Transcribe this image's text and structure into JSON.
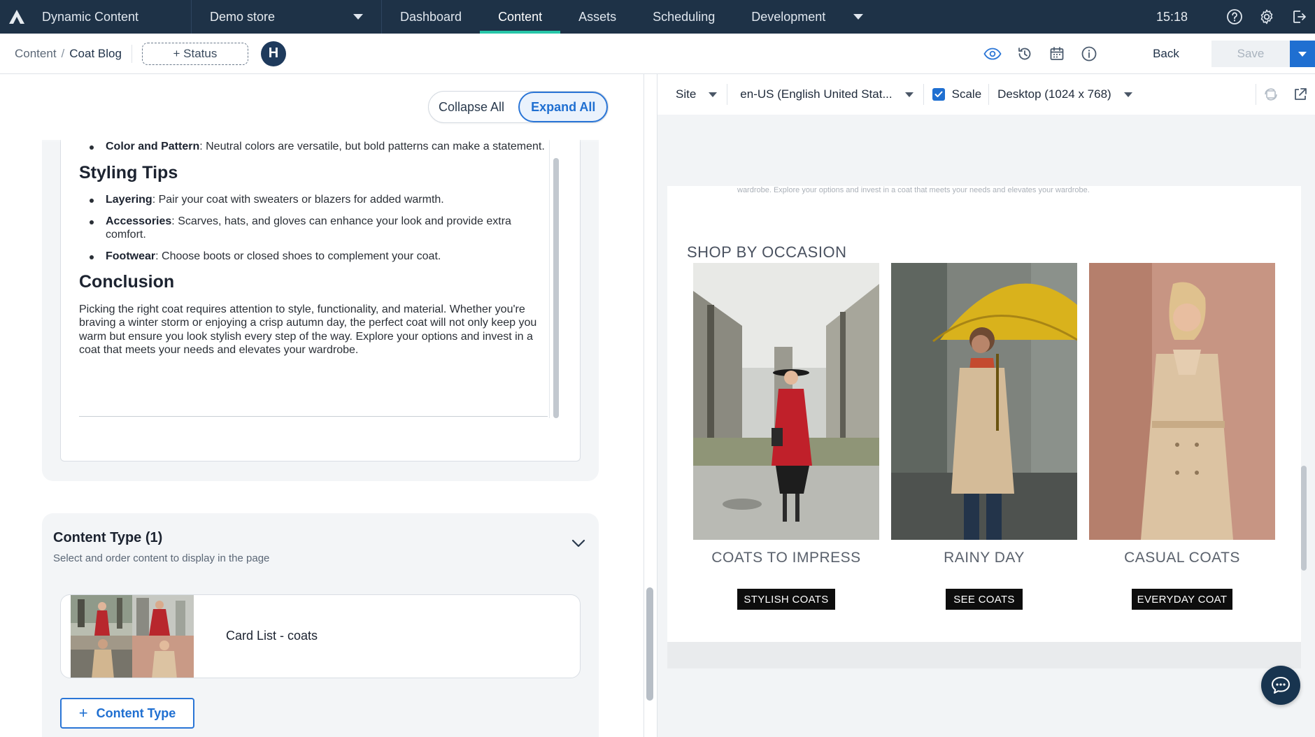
{
  "app": {
    "title": "Dynamic Content",
    "store": "Demo store",
    "time": "15:18"
  },
  "nav": {
    "tabs": [
      {
        "label": "Dashboard"
      },
      {
        "label": "Content"
      },
      {
        "label": "Assets"
      },
      {
        "label": "Scheduling"
      },
      {
        "label": "Development"
      }
    ],
    "active": "Content"
  },
  "subbar": {
    "breadcrumb_root": "Content",
    "breadcrumb_sep": "/",
    "breadcrumb_current": "Coat Blog",
    "status_label": "+ Status",
    "avatar_initial": "H",
    "back_label": "Back",
    "save_label": "Save"
  },
  "editor": {
    "collapse_all": "Collapse All",
    "expand_all": "Expand All",
    "cut_item_bold": "Color and Pattern",
    "cut_item_text": ": Neutral colors are versatile, but bold patterns can make a statement.",
    "styling_heading": "Styling Tips",
    "styling_items": [
      {
        "bold": "Layering",
        "text": ": Pair your coat with sweaters or blazers for added warmth."
      },
      {
        "bold": "Accessories",
        "text": ": Scarves, hats, and gloves can enhance your look and provide extra comfort."
      },
      {
        "bold": "Footwear",
        "text": ": Choose boots or closed shoes to complement your coat."
      }
    ],
    "conclusion_heading": "Conclusion",
    "conclusion_text": "Picking the right coat requires attention to style, functionality, and material. Whether you're braving a winter storm or enjoying a crisp autumn day, the perfect coat will not only keep you warm but ensure you look stylish every step of the way. Explore your options and invest in a coat that meets your needs and elevates your wardrobe."
  },
  "content_type": {
    "title": "Content Type (1)",
    "subtitle": "Select and order content to display in the page",
    "item_label": "Card List - coats",
    "add_label": "Content Type"
  },
  "preview": {
    "site_label": "Site",
    "locale_label": "en-US (English United Stat...",
    "scale_label": "Scale",
    "device_label": "Desktop (1024 x 768)",
    "faded_text": "wardrobe. Explore your options and invest in a coat that meets your needs and elevates your wardrobe.",
    "section_title": "SHOP BY OCCASION",
    "cards": [
      {
        "label": "COATS TO IMPRESS",
        "button": "STYLISH COATS"
      },
      {
        "label": "RAINY DAY",
        "button": "SEE COATS"
      },
      {
        "label": "CASUAL COATS",
        "button": "EVERYDAY COAT"
      }
    ]
  },
  "colors": {
    "nav_bg": "#1e3247",
    "accent_teal": "#27c6a8",
    "primary_blue": "#1f6fd1",
    "coat_red": "#c0202a",
    "umbrella_yellow": "#d9b21c",
    "coat_beige": "#d4bb98"
  },
  "icons": {
    "logo": "amplience-logo-icon",
    "help": "help-icon",
    "settings": "gear-icon",
    "logout": "logout-icon",
    "preview": "eye-icon",
    "history": "history-icon",
    "schedule": "calendar-icon",
    "info": "info-icon",
    "chat": "chat-icon"
  }
}
